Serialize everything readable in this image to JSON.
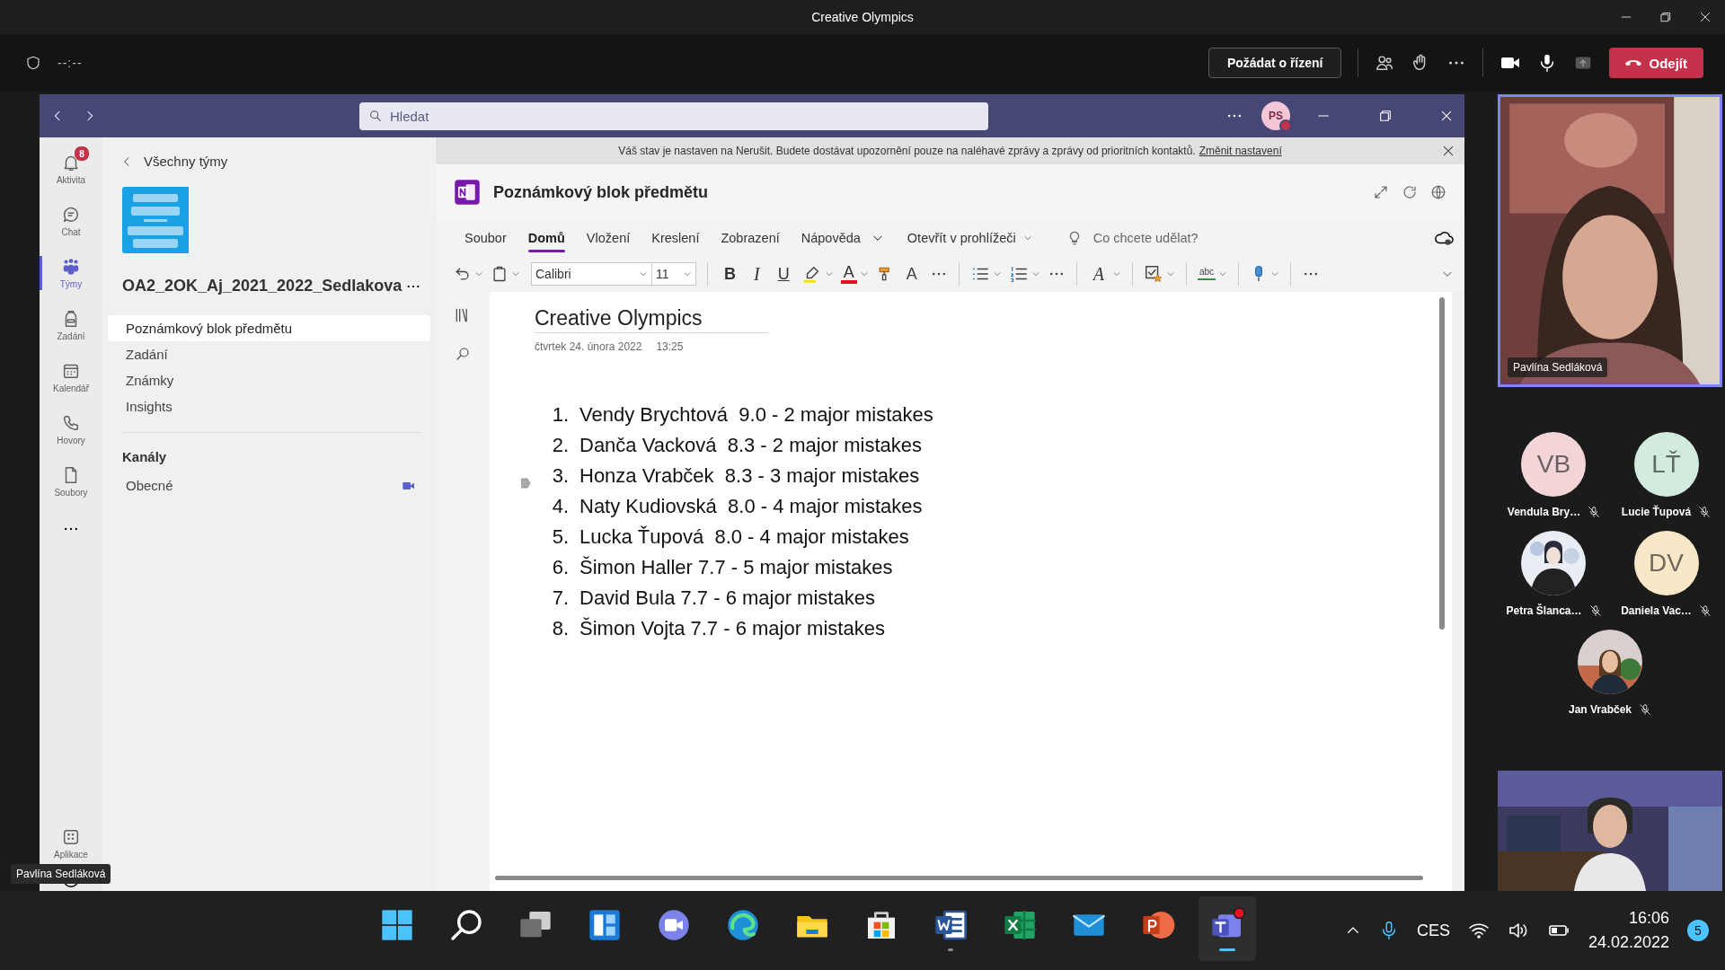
{
  "window": {
    "title": "Creative Olympics"
  },
  "meeting_bar": {
    "timer": "--:--",
    "control_button": "Požádat o řízení",
    "leave_button": "Odejít"
  },
  "teams_header": {
    "search": {
      "placeholder": "Hledat"
    },
    "avatar": "PS"
  },
  "rail": {
    "items": [
      {
        "label": "Aktivita",
        "badge": "8",
        "selected": false
      },
      {
        "label": "Chat",
        "selected": false
      },
      {
        "label": "Týmy",
        "selected": true
      },
      {
        "label": "Zadání",
        "selected": false
      },
      {
        "label": "Kalendář",
        "selected": false
      },
      {
        "label": "Hovory",
        "selected": false
      },
      {
        "label": "Soubory",
        "selected": false
      }
    ],
    "bottom_items": [
      {
        "label": "Aplikace"
      }
    ]
  },
  "tooltip": "Pavlína Sedláková",
  "team_panel": {
    "back_link": "Všechny týmy",
    "team_name": "OA2_2OK_Aj_2021_2022_Sedlakova",
    "tabs": [
      {
        "label": "Poznámkový blok předmětu",
        "selected": true
      },
      {
        "label": "Zadání",
        "selected": false
      },
      {
        "label": "Známky",
        "selected": false
      },
      {
        "label": "Insights",
        "selected": false
      }
    ],
    "channels_heading": "Kanály",
    "channels": [
      {
        "label": "Obecné",
        "meeting_active": true
      }
    ]
  },
  "banner": {
    "text": "Váš stav je nastaven na Nerušit. Budete dostávat upozornění pouze na naléhavé zprávy a zprávy od prioritních kontaktů.",
    "link": "Změnit nastavení"
  },
  "app_header": {
    "title": "Poznámkový blok předmětu"
  },
  "ribbon": {
    "tabs": [
      {
        "label": "Soubor",
        "selected": false
      },
      {
        "label": "Domů",
        "selected": true
      },
      {
        "label": "Vložení",
        "selected": false
      },
      {
        "label": "Kreslení",
        "selected": false
      },
      {
        "label": "Zobrazení",
        "selected": false
      },
      {
        "label": "Nápověda",
        "selected": false
      }
    ],
    "open_in_browser": "Otevřít v prohlížeči",
    "search": {
      "placeholder": "Co chcete udělat?"
    },
    "toolbar": [
      {
        "kind": "undo"
      },
      {
        "kind": "paste"
      },
      {
        "kind": "font",
        "value": "Calibri"
      },
      {
        "kind": "size",
        "value": "11"
      },
      {
        "kind": "separator"
      },
      {
        "kind": "bold",
        "glyph": "B"
      },
      {
        "kind": "italic",
        "glyph": "I"
      },
      {
        "kind": "underline",
        "glyph": "U"
      },
      {
        "kind": "highlight"
      },
      {
        "kind": "font-color",
        "glyph": "A"
      },
      {
        "kind": "painter"
      },
      {
        "kind": "clear-format",
        "glyph": "A"
      },
      {
        "kind": "more"
      },
      {
        "kind": "separator"
      },
      {
        "kind": "bullets"
      },
      {
        "kind": "numbering"
      },
      {
        "kind": "more"
      },
      {
        "kind": "separator"
      },
      {
        "kind": "styles",
        "glyph": "A"
      },
      {
        "kind": "separator"
      },
      {
        "kind": "tag"
      },
      {
        "kind": "separator"
      },
      {
        "kind": "spelling",
        "glyph": "abc"
      },
      {
        "kind": "separator"
      },
      {
        "kind": "dictate"
      },
      {
        "kind": "separator"
      },
      {
        "kind": "more"
      }
    ]
  },
  "page": {
    "title": "Creative Olympics",
    "date": "čtvrtek 24. února 2022",
    "time": "13:25",
    "items": [
      {
        "number": "1.",
        "text": "Vendy Brychtová  9.0 - 2 major mistakes"
      },
      {
        "number": "2.",
        "text": "Danča Vacková  8.3 - 2 major mistakes"
      },
      {
        "number": "3.",
        "text": "Honza Vrabček  8.3 - 3 major mistakes",
        "tagged": true
      },
      {
        "number": "4.",
        "text": "Naty Kudiovská  8.0 - 4 major mistakes"
      },
      {
        "number": "5.",
        "text": "Lucka Ťupová  8.0 - 4 major mistakes"
      },
      {
        "number": "6.",
        "text": "Šimon Haller 7.7 - 5 major mistakes"
      },
      {
        "number": "7.",
        "text": "David Bula 7.7 - 6 major mistakes"
      },
      {
        "number": "8.",
        "text": "Šimon Vojta 7.7 - 6 major mistakes"
      }
    ]
  },
  "participants": {
    "main_video": {
      "kind": "picture",
      "name": "Pavlína Sedláková"
    },
    "tiles": [
      {
        "kind": "initials",
        "initials": "VB",
        "name": "Vendula Bry…",
        "color": "#f3d5d8",
        "muted": true
      },
      {
        "kind": "initials",
        "initials": "LŤ",
        "name": "Lucie Ťupová",
        "color": "#d2ebdf",
        "muted": true
      },
      {
        "kind": "picture",
        "name": "Petra Šlanca…",
        "muted": true
      },
      {
        "kind": "initials",
        "initials": "DV",
        "name": "Daniela Vac…",
        "color": "#f8e8c8",
        "muted": true
      },
      {
        "kind": "picture",
        "name": "Jan Vrabček",
        "muted": true
      }
    ]
  },
  "taskbar": {
    "apps": [
      {
        "kind": "start",
        "open": false,
        "selected": false
      },
      {
        "kind": "search",
        "open": false,
        "selected": false
      },
      {
        "kind": "task-view",
        "open": false,
        "selected": false
      },
      {
        "kind": "widgets",
        "open": false,
        "selected": false
      },
      {
        "kind": "chat",
        "open": false,
        "selected": false
      },
      {
        "kind": "edge",
        "open": false,
        "selected": false
      },
      {
        "kind": "explorer",
        "open": false,
        "selected": false
      },
      {
        "kind": "store",
        "open": false,
        "selected": false
      },
      {
        "kind": "word",
        "open": true,
        "selected": false
      },
      {
        "kind": "excel",
        "open": false,
        "selected": false
      },
      {
        "kind": "mail",
        "open": false,
        "selected": false
      },
      {
        "kind": "powerpoint",
        "open": false,
        "selected": false
      },
      {
        "kind": "teams",
        "open": true,
        "selected": true
      }
    ],
    "language": "CES",
    "time": "16:06",
    "date": "24.02.2022",
    "notifications": "5"
  }
}
